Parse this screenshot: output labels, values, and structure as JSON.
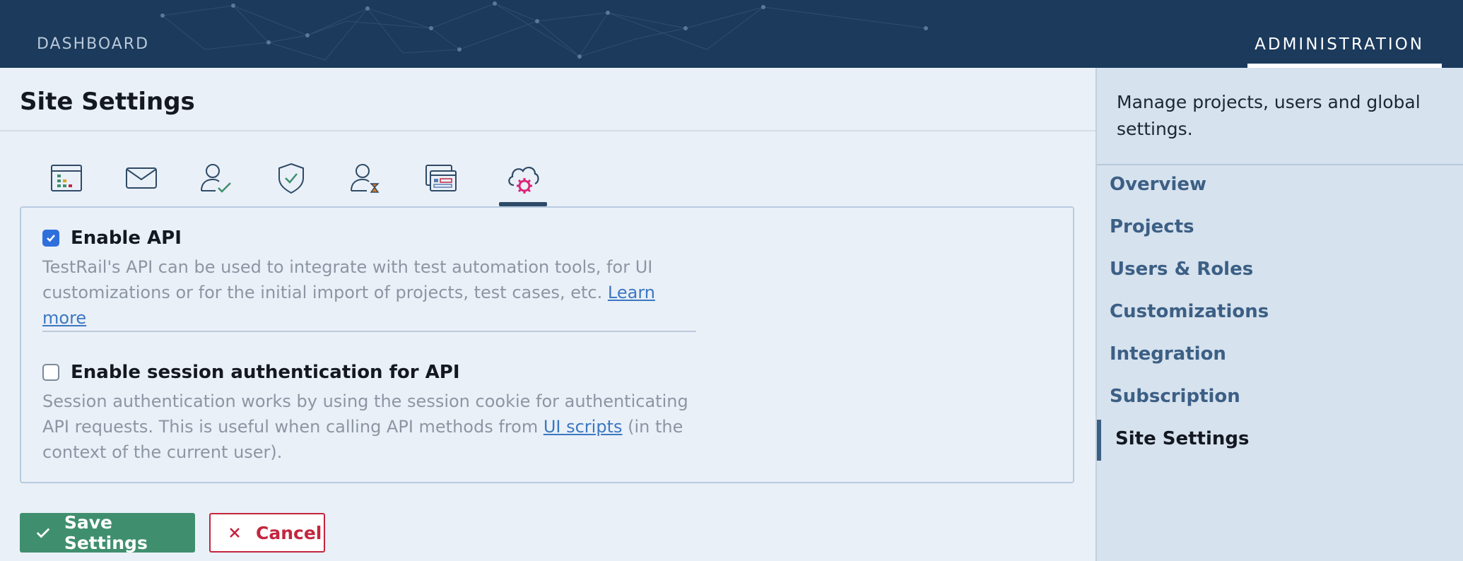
{
  "topbar": {
    "dashboard_label": "DASHBOARD",
    "administration_label": "ADMINISTRATION"
  },
  "page": {
    "title": "Site Settings"
  },
  "tabs": [
    {
      "icon": "grid-icon"
    },
    {
      "icon": "mail-icon"
    },
    {
      "icon": "user-check-icon"
    },
    {
      "icon": "shield-check-icon"
    },
    {
      "icon": "user-hourglass-icon"
    },
    {
      "icon": "windows-icon"
    },
    {
      "icon": "cloud-gear-icon",
      "active": true
    }
  ],
  "settings": {
    "enable_api": {
      "label": "Enable API",
      "checked": true,
      "desc_before": "TestRail's API can be used to integrate with test automation tools, for UI customizations or for the initial import of projects, test cases, etc. ",
      "link": "Learn more"
    },
    "session_auth": {
      "label": "Enable session authentication for API",
      "checked": false,
      "desc_before": "Session authentication works by using the session cookie for authenticating API requests. This is useful when calling API methods from ",
      "link": "UI scripts",
      "desc_after": " (in the context of the current user)."
    }
  },
  "buttons": {
    "save": "Save Settings",
    "cancel": "Cancel"
  },
  "sidebar": {
    "description": "Manage projects, users and global settings.",
    "items": [
      {
        "label": "Overview"
      },
      {
        "label": "Projects"
      },
      {
        "label": "Users & Roles"
      },
      {
        "label": "Customizations"
      },
      {
        "label": "Integration"
      },
      {
        "label": "Subscription"
      },
      {
        "label": "Site Settings",
        "active": true
      }
    ]
  },
  "colors": {
    "header_bg": "#1b3a5c",
    "save_green": "#3f8f6e",
    "cancel_red": "#c4253e",
    "link_blue": "#3b78c0",
    "checkbox_blue": "#2f6fdc"
  }
}
